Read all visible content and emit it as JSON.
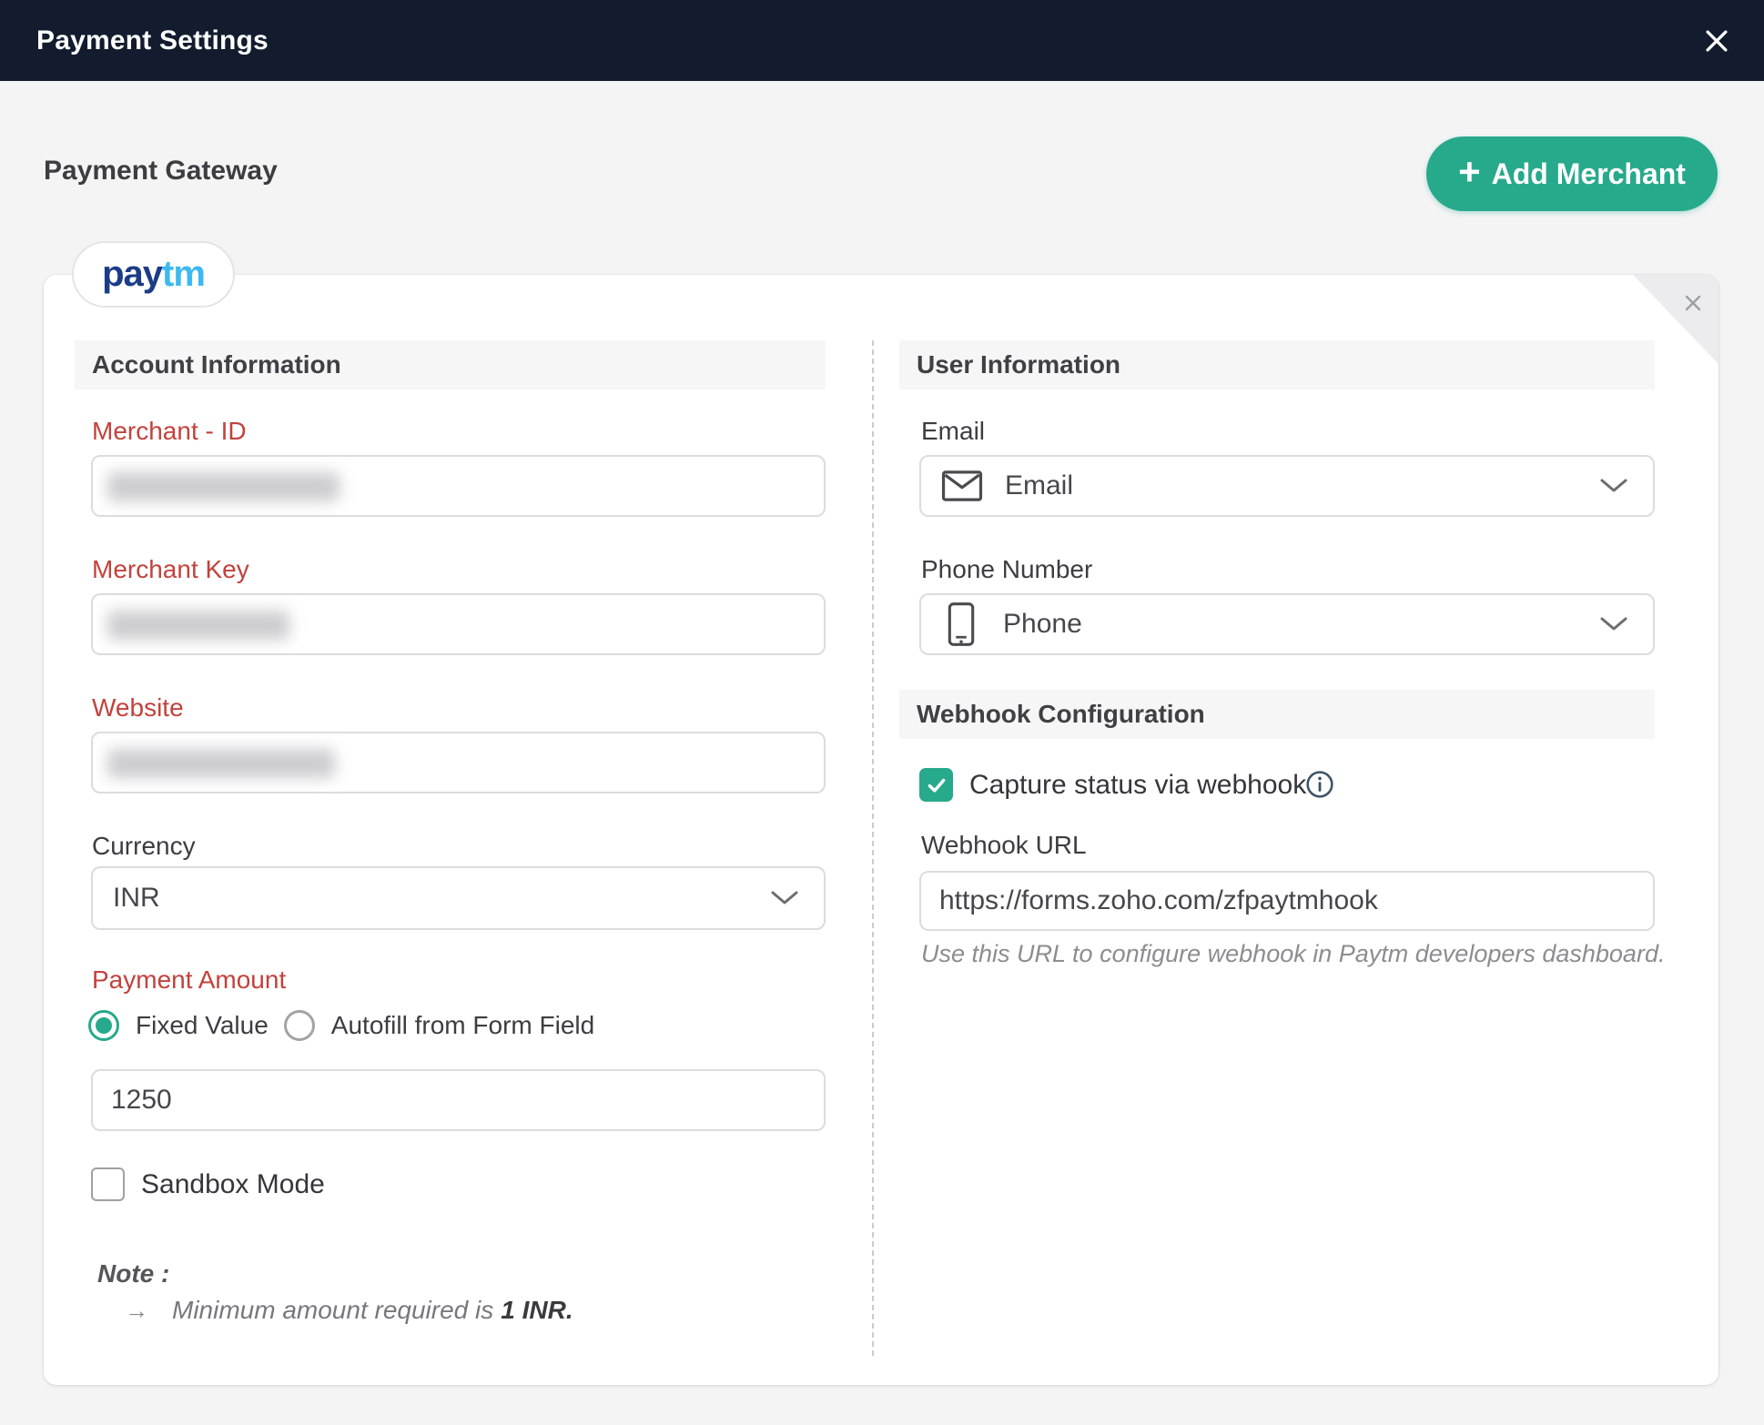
{
  "header": {
    "title": "Payment Settings"
  },
  "page": {
    "heading": "Payment Gateway"
  },
  "actions": {
    "add_merchant": "Add Merchant"
  },
  "icons": {
    "plus": "+",
    "arrow": "→"
  },
  "tabs": {
    "paytm": {
      "pay": "pay",
      "tm": "tm"
    }
  },
  "account": {
    "section_title": "Account Information",
    "merchant_id": {
      "label": "Merchant - ID",
      "masked": true
    },
    "merchant_key": {
      "label": "Merchant Key",
      "masked": true
    },
    "website": {
      "label": "Website",
      "masked": true
    },
    "currency": {
      "label": "Currency",
      "value": "INR"
    },
    "payment_amount": {
      "label": "Payment Amount",
      "options": [
        "Fixed Value",
        "Autofill from Form Field"
      ],
      "selected": "Fixed Value",
      "value": "1250"
    },
    "sandbox": {
      "label": "Sandbox Mode",
      "checked": false
    },
    "note": {
      "title": "Note :",
      "items": [
        {
          "prefix": "Minimum amount required is",
          "strong": "1 INR."
        }
      ]
    }
  },
  "user": {
    "section_title": "User Information",
    "email": {
      "label": "Email",
      "selected": "Email"
    },
    "phone": {
      "label": "Phone Number",
      "selected": "Phone"
    }
  },
  "webhook": {
    "section_title": "Webhook Configuration",
    "capture": {
      "label": "Capture status via webhook",
      "checked": true
    },
    "url": {
      "label": "Webhook URL",
      "value": "https://forms.zoho.com/zfpaytmhook"
    },
    "helper": "Use this URL to configure webhook in Paytm developers dashboard."
  },
  "colors": {
    "accent_green": "#27a98c",
    "label_red": "#c2423d",
    "header_bg": "#131c2e",
    "paytm_dark": "#1b3c87",
    "paytm_light": "#3db9f0"
  }
}
